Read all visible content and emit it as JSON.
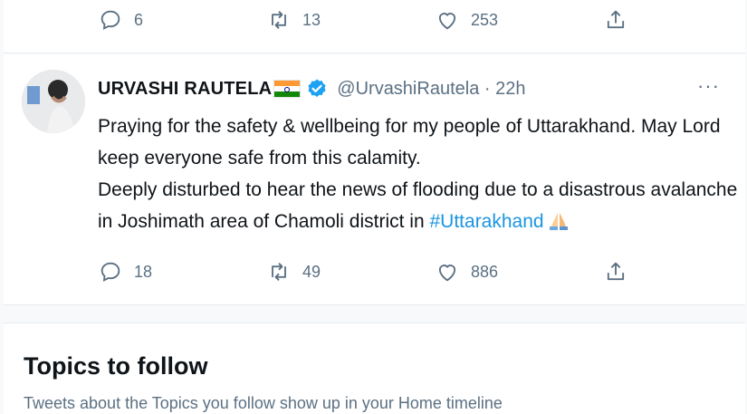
{
  "prev_tweet": {
    "replies": "6",
    "retweets": "13",
    "likes": "253"
  },
  "tweet": {
    "display_name": "URVASHI RAUTELA",
    "handle_time": "@UrvashiRautela · 22h",
    "more": "···",
    "line1": "Praying for the safety & wellbeing for my people of Uttarakhand. May Lord",
    "line2": "keep everyone safe from this calamity.",
    "line3": "Deeply disturbed to hear the news of flooding due to a disastrous avalanche",
    "line4_prefix": "in Joshimath area of Chamoli district in ",
    "hashtag": "#Uttarakhand",
    "replies": "18",
    "retweets": "49",
    "likes": "886"
  },
  "topics": {
    "title": "Topics to follow",
    "subtitle": "Tweets about the Topics you follow show up in your Home timeline"
  },
  "colors": {
    "accent": "#1b95e0",
    "muted": "#5b7083",
    "verified": "#1da1f2"
  },
  "icons": [
    "reply-icon",
    "retweet-icon",
    "like-icon",
    "share-icon",
    "verified-icon",
    "india-flag-icon",
    "folded-hands-icon",
    "more-icon"
  ]
}
